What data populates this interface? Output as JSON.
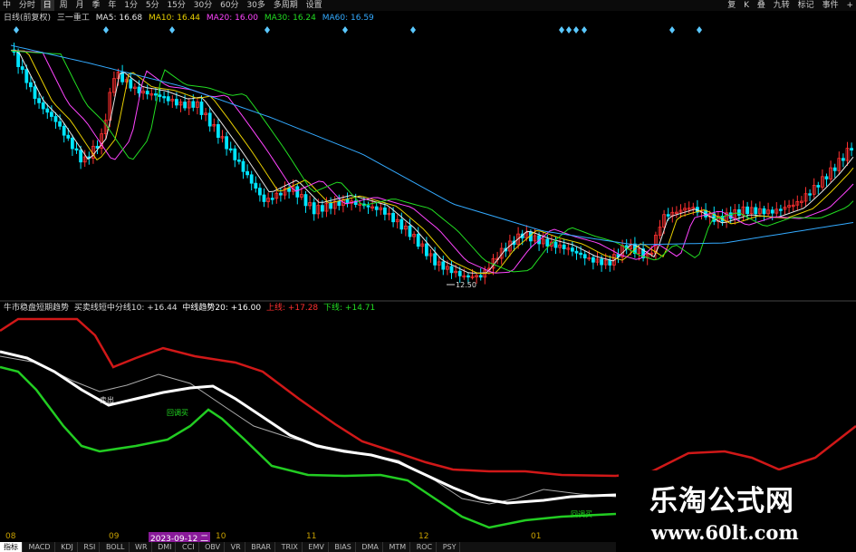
{
  "toolbar": {
    "items": [
      "中",
      "分时",
      "日",
      "周",
      "月",
      "季",
      "年",
      "1分",
      "5分",
      "15分",
      "30分",
      "60分",
      "30多",
      "多周期",
      "设置"
    ],
    "right_items": [
      "复",
      "K",
      "叠",
      "九转",
      "标记",
      "事件",
      "+"
    ]
  },
  "price_panel": {
    "period_label": "日线(前复权)",
    "indicator_name": "三一重工",
    "ma": [
      {
        "label": "MA5: 16.68",
        "color": "#e8e8e8"
      },
      {
        "label": "MA10: 16.44",
        "color": "#e8d000"
      },
      {
        "label": "MA20: 16.00",
        "color": "#ff44ff"
      },
      {
        "label": "MA30: 16.24",
        "color": "#22dd22"
      },
      {
        "label": "MA60: 16.59",
        "color": "#33aaff"
      }
    ],
    "low_marker": "12.50"
  },
  "indicator_panel": {
    "labels": [
      {
        "text": "牛市稳盘短期趋势",
        "color": "#ddd"
      },
      {
        "text": "买卖线短中分线10: +16.44",
        "color": "#ddd"
      },
      {
        "text": "中线趋势20: +16.00",
        "color": "#fff"
      },
      {
        "text": "上线: +17.28",
        "color": "#ff3030"
      },
      {
        "text": "下线: +14.71",
        "color": "#22dd22"
      }
    ],
    "annotations": [
      "卖出",
      "回调买",
      "回调买"
    ]
  },
  "dates": [
    "08",
    "09",
    "2023-09-12 二",
    "10",
    "11",
    "12",
    "01"
  ],
  "bottom_tabs": [
    "指标",
    "MACD",
    "KDJ",
    "RSI",
    "BOLL",
    "WR",
    "DMI",
    "CCI",
    "OBV",
    "VR",
    "BRAR",
    "TRIX",
    "EMV",
    "BIAS",
    "DMA",
    "MTM",
    "ROC",
    "PSY"
  ],
  "watermark": {
    "title": "乐淘公式网",
    "url": "www.60lt.com"
  },
  "colors": {
    "up": "#ff3030",
    "down": "#00e5ff",
    "bg": "#000000"
  }
}
